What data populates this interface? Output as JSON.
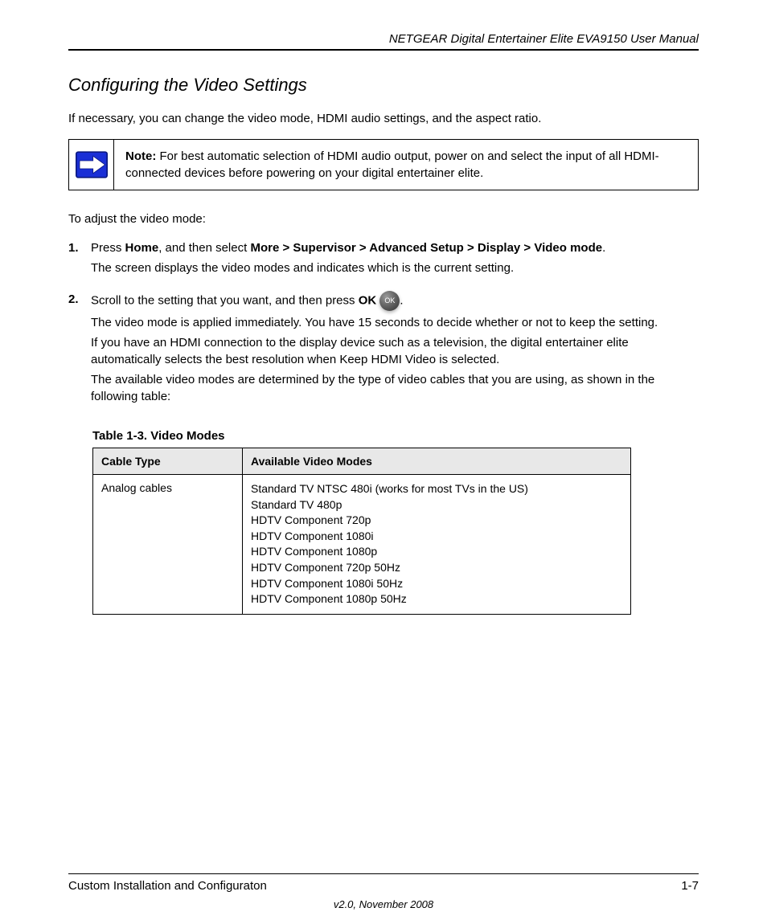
{
  "header": {
    "title": "NETGEAR Digital Entertainer Elite EVA9150 User Manual"
  },
  "section": {
    "heading": "Configuring the Video Settings",
    "intro": "If necessary, you can change the video mode, HDMI audio settings, and the aspect ratio."
  },
  "note": {
    "label": "Note:",
    "text": "For best automatic selection of HDMI audio output, power on and select the input of all HDMI-connected devices before powering on your digital entertainer elite."
  },
  "steps_intro": "To adjust the video mode:",
  "steps": [
    {
      "pre": "Press ",
      "bold": "Home",
      "post": ", and then select ",
      "bold2": "More > Supervisor > Advanced Setup > Display > Video mode",
      "post2": ".",
      "line2": "The screen displays the video modes and indicates which is the current setting."
    },
    {
      "pre": "Scroll to the setting that you want, and then press ",
      "bold": "OK",
      "ok_icon": true,
      "post": ".",
      "line2a": "The video mode is applied immediately. You have 15 seconds to decide whether or not to keep the setting.",
      "line2b": "If you have an HDMI connection to the display device such as a television, the digital entertainer elite automatically selects the best resolution when Keep HDMI Video is selected.",
      "line2c": "The available video modes are determined by the type of video cables that you are using, as shown in the following table:"
    }
  ],
  "table": {
    "caption_label": "Table 1-3.",
    "caption_text": "Video Modes",
    "headers": [
      "Cable Type",
      "Available Video Modes"
    ],
    "rows": [
      {
        "col1": "Analog cables",
        "options": [
          "Standard TV NTSC 480i (works for most TVs in the US)",
          "Standard TV 480p",
          "HDTV Component 720p",
          "HDTV Component 1080i",
          "HDTV Component 1080p",
          "HDTV Component 720p 50Hz",
          "HDTV Component 1080i 50Hz",
          "HDTV Component 1080p 50Hz"
        ]
      }
    ]
  },
  "footer": {
    "left": "Custom Installation and Configuraton",
    "right": "1-7",
    "date": "v2.0, November 2008"
  },
  "icons": {
    "ok": "OK"
  }
}
